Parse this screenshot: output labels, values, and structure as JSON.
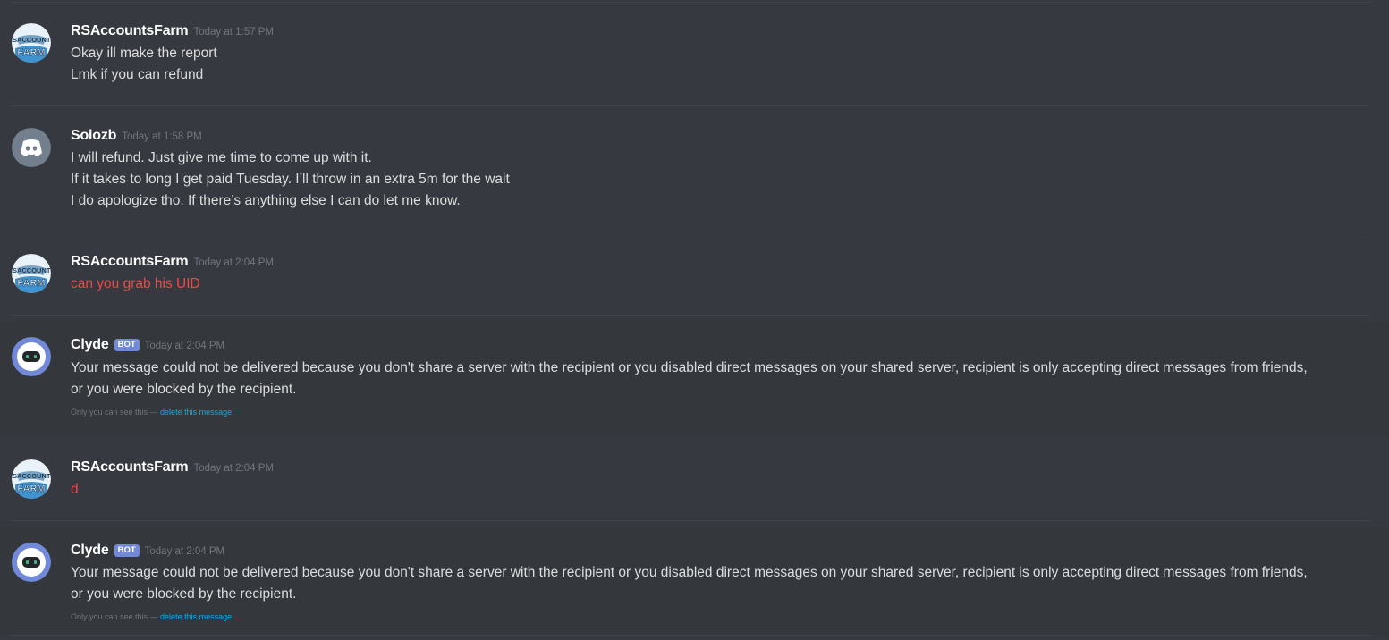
{
  "messages": [
    {
      "username": "RSAccountsFarm",
      "timestamp": "Today at 1:57 PM",
      "avatar": "rsaccountsfarm-logo",
      "lines": [
        "Okay ill make the report",
        "Lmk if you can refund"
      ]
    },
    {
      "username": "Solozb",
      "timestamp": "Today at 1:58 PM",
      "avatar": "discord-default-avatar",
      "lines": [
        "I will refund. Just give me time to come up with it.",
        "If it takes to long I get paid Tuesday. I’ll throw in an extra 5m for the wait",
        "I do apologize tho. If there’s anything else I can do let me know."
      ]
    },
    {
      "username": "RSAccountsFarm",
      "timestamp": "Today at 2:04 PM",
      "avatar": "rsaccountsfarm-logo",
      "lines": [
        "can you grab his UID"
      ],
      "failed": true
    },
    {
      "username": "Clyde",
      "badge": "BOT",
      "timestamp": "Today at 2:04 PM",
      "avatar": "clyde-bot-avatar",
      "lines": [
        "Your message could not be delivered because you don't share a server with the recipient or you disabled direct messages on your shared server, recipient is only accepting direct messages from friends,",
        "or you were blocked by the recipient."
      ],
      "ephemeral_note": "Only you can see this — ",
      "ephemeral_link": "delete this message",
      "ephemeral_end": "."
    },
    {
      "username": "RSAccountsFarm",
      "timestamp": "Today at 2:04 PM",
      "avatar": "rsaccountsfarm-logo",
      "lines": [
        "d"
      ],
      "failed": true
    },
    {
      "username": "Clyde",
      "badge": "BOT",
      "timestamp": "Today at 2:04 PM",
      "avatar": "clyde-bot-avatar",
      "lines": [
        "Your message could not be delivered because you don't share a server with the recipient or you disabled direct messages on your shared server, recipient is only accepting direct messages from friends,",
        "or you were blocked by the recipient."
      ],
      "ephemeral_note": "Only you can see this — ",
      "ephemeral_link": "delete this message",
      "ephemeral_end": "."
    }
  ],
  "colors": {
    "background": "#36393f",
    "failed_text": "#f04747",
    "bot_badge": "#7289da",
    "link": "#00b0f4"
  },
  "avatar_text": {
    "top": "RSACCOUNTS",
    "bottom": "FARM"
  }
}
